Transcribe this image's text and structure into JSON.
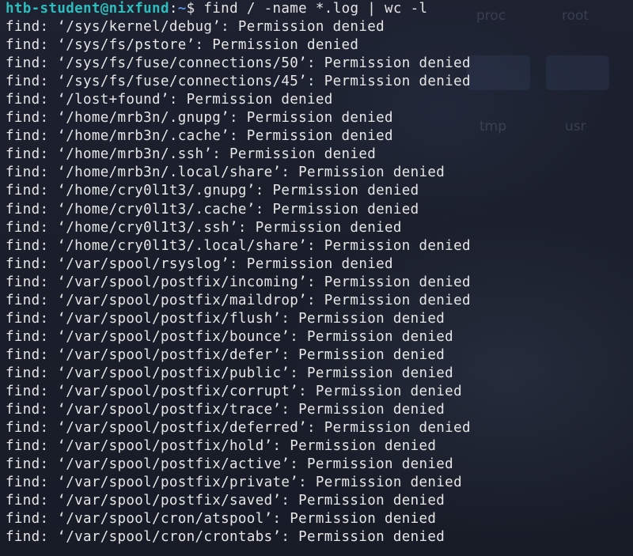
{
  "terminal": {
    "prompt": {
      "user_host": "htb-student@nixfund",
      "colon": ":",
      "path": "~",
      "dollar": "$ ",
      "command": "find / -name *.log | wc -l"
    },
    "output": [
      "find: ‘/sys/kernel/debug’: Permission denied",
      "find: ‘/sys/fs/pstore’: Permission denied",
      "find: ‘/sys/fs/fuse/connections/50’: Permission denied",
      "find: ‘/sys/fs/fuse/connections/45’: Permission denied",
      "find: ‘/lost+found’: Permission denied",
      "find: ‘/home/mrb3n/.gnupg’: Permission denied",
      "find: ‘/home/mrb3n/.cache’: Permission denied",
      "find: ‘/home/mrb3n/.ssh’: Permission denied",
      "find: ‘/home/mrb3n/.local/share’: Permission denied",
      "find: ‘/home/cry0l1t3/.gnupg’: Permission denied",
      "find: ‘/home/cry0l1t3/.cache’: Permission denied",
      "find: ‘/home/cry0l1t3/.ssh’: Permission denied",
      "find: ‘/home/cry0l1t3/.local/share’: Permission denied",
      "find: ‘/var/spool/rsyslog’: Permission denied",
      "find: ‘/var/spool/postfix/incoming’: Permission denied",
      "find: ‘/var/spool/postfix/maildrop’: Permission denied",
      "find: ‘/var/spool/postfix/flush’: Permission denied",
      "find: ‘/var/spool/postfix/bounce’: Permission denied",
      "find: ‘/var/spool/postfix/defer’: Permission denied",
      "find: ‘/var/spool/postfix/public’: Permission denied",
      "find: ‘/var/spool/postfix/corrupt’: Permission denied",
      "find: ‘/var/spool/postfix/trace’: Permission denied",
      "find: ‘/var/spool/postfix/deferred’: Permission denied",
      "find: ‘/var/spool/postfix/hold’: Permission denied",
      "find: ‘/var/spool/postfix/active’: Permission denied",
      "find: ‘/var/spool/postfix/private’: Permission denied",
      "find: ‘/var/spool/postfix/saved’: Permission denied",
      "find: ‘/var/spool/cron/atspool’: Permission denied",
      "find: ‘/var/spool/cron/crontabs’: Permission denied"
    ]
  },
  "background": {
    "folder_labels": [
      "proc",
      "root",
      "tmp",
      "usr"
    ]
  }
}
